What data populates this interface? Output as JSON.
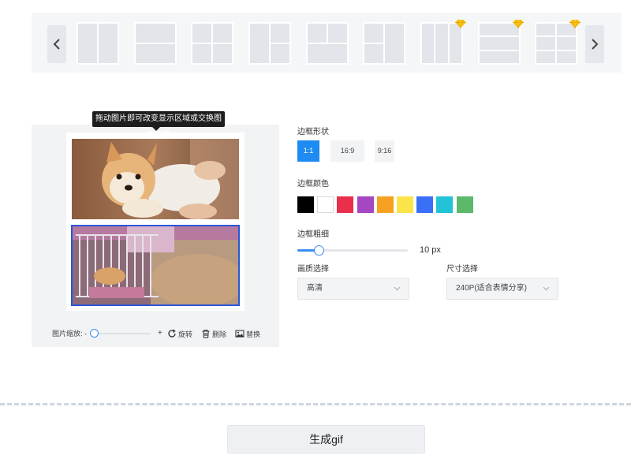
{
  "layout_strip": {
    "prev_label": "",
    "next_label": "",
    "templates": [
      {
        "name": "two-columns",
        "vip": false
      },
      {
        "name": "two-rows",
        "vip": false
      },
      {
        "name": "four-grid",
        "vip": false
      },
      {
        "name": "left-big-right-two",
        "vip": false
      },
      {
        "name": "top-two-bottom-one",
        "vip": false
      },
      {
        "name": "left-two-right-one",
        "vip": false
      },
      {
        "name": "three-columns",
        "vip": true
      },
      {
        "name": "three-rows",
        "vip": true
      },
      {
        "name": "six-grid",
        "vip": true
      }
    ]
  },
  "editor": {
    "tooltip": "拖动图片即可改变显示区域或交换图片位置",
    "zoom_label": "图片缩放: -",
    "zoom_plus": "+",
    "zoom_level": 0,
    "rotate_label": "旋转",
    "delete_label": "删除",
    "replace_label": "替换"
  },
  "settings": {
    "border_shape_label": "边框形状",
    "ratios": [
      {
        "label": "1:1",
        "active": true
      },
      {
        "label": "16:9",
        "active": false
      },
      {
        "label": "9:16",
        "active": false
      }
    ],
    "border_color_label": "边框颜色",
    "colors": [
      "#000000",
      "#ffffff",
      "#ea2f4d",
      "#a546c2",
      "#f7a122",
      "#fbe449",
      "#3a6ff7",
      "#22c3d7",
      "#5cb96c"
    ],
    "border_width_label": "边框粗细",
    "border_width_value": "10 px",
    "border_width_fraction": 0.18,
    "quality_label": "画质选择",
    "quality_value": "高清",
    "size_label": "尺寸选择",
    "size_value": "240P(适合表情分享)"
  },
  "generate_label": "生成gif",
  "accent_color": "#1d8bf1"
}
